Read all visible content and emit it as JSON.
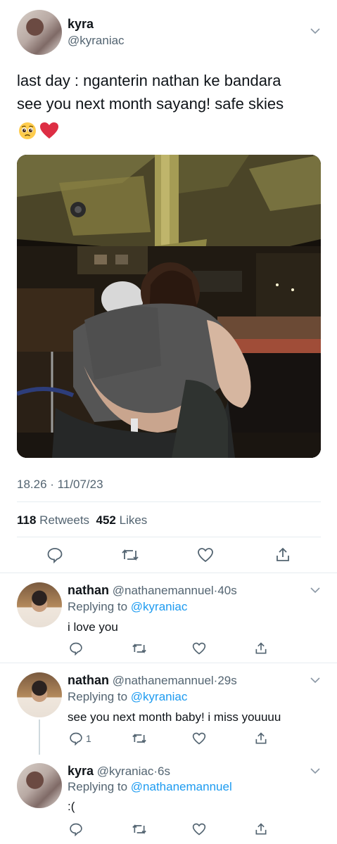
{
  "main_tweet": {
    "author_name": "kyra",
    "author_handle": "@kyraniac",
    "text_line1": "last day : nganterin nathan ke bandara",
    "text_line2": "see you next month sayang! safe skies",
    "emojis": [
      "pleading-face",
      "red-heart"
    ],
    "timestamp": "18.26 · 11/07/23",
    "retweets_count": "118",
    "retweets_label": "Retweets",
    "likes_count": "452",
    "likes_label": "Likes"
  },
  "replies": [
    {
      "name": "nathan",
      "handle": "@nathanemannuel",
      "time": "40s",
      "replying_prefix": "Replying to",
      "replying_to": "@kyraniac",
      "text": "i love you",
      "reply_count": ""
    },
    {
      "name": "nathan",
      "handle": "@nathanemannuel",
      "time": "29s",
      "replying_prefix": "Replying to",
      "replying_to": "@kyraniac",
      "text": "see you next month baby! i miss youuuu",
      "reply_count": "1"
    },
    {
      "name": "kyra",
      "handle": "@kyraniac",
      "time": "6s",
      "replying_prefix": "Replying to",
      "replying_to": "@nathanemannuel",
      "text": ":(",
      "reply_count": ""
    }
  ],
  "colors": {
    "text_primary": "#0f1419",
    "text_secondary": "#536471",
    "link": "#1d9bf0",
    "divider": "#e6ecf0",
    "heart_emoji": "#e0245e"
  }
}
